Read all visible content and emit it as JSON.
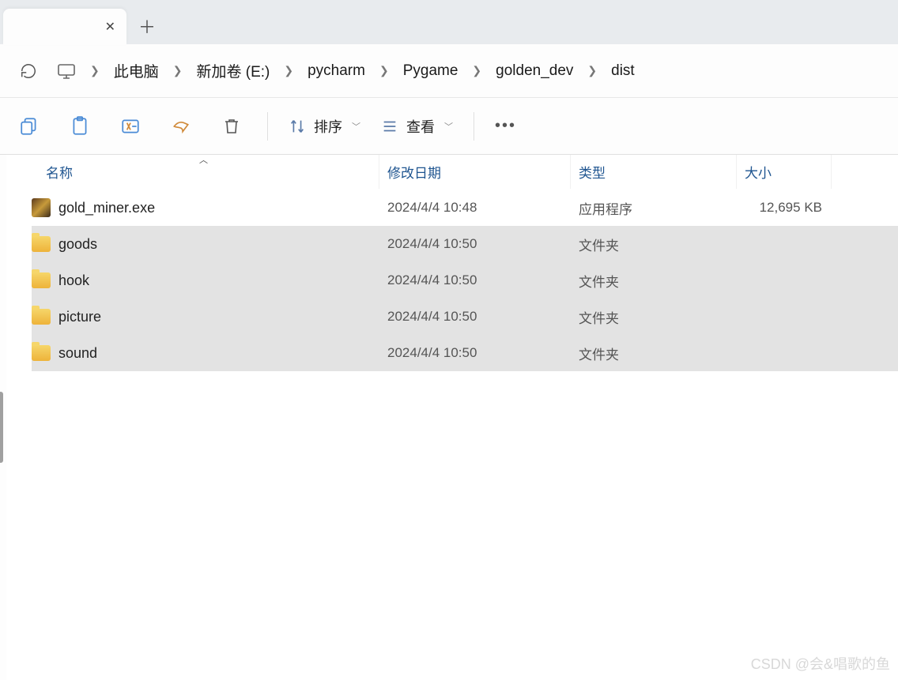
{
  "breadcrumb": {
    "monitor_icon": "monitor",
    "items": [
      "此电脑",
      "新加卷 (E:)",
      "pycharm",
      "Pygame",
      "golden_dev",
      "dist"
    ]
  },
  "toolbar": {
    "sort_label": "排序",
    "view_label": "查看"
  },
  "columns": {
    "name": "名称",
    "modified": "修改日期",
    "type": "类型",
    "size": "大小"
  },
  "rows": [
    {
      "icon": "exe",
      "name": "gold_miner.exe",
      "modified": "2024/4/4 10:48",
      "type": "应用程序",
      "size": "12,695 KB",
      "selected": false
    },
    {
      "icon": "folder",
      "name": "goods",
      "modified": "2024/4/4 10:50",
      "type": "文件夹",
      "size": "",
      "selected": true
    },
    {
      "icon": "folder",
      "name": "hook",
      "modified": "2024/4/4 10:50",
      "type": "文件夹",
      "size": "",
      "selected": true
    },
    {
      "icon": "folder",
      "name": "picture",
      "modified": "2024/4/4 10:50",
      "type": "文件夹",
      "size": "",
      "selected": true
    },
    {
      "icon": "folder",
      "name": "sound",
      "modified": "2024/4/4 10:50",
      "type": "文件夹",
      "size": "",
      "selected": true
    }
  ],
  "watermark": "CSDN @会&唱歌的鱼"
}
